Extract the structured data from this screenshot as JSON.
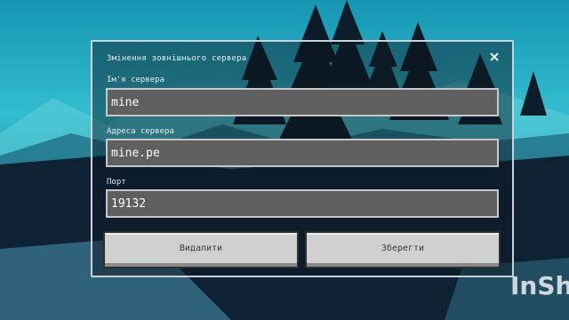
{
  "dialog": {
    "title": "Змінення зовнішнього сервера",
    "close_icon": "close-icon"
  },
  "fields": {
    "server_name": {
      "label": "Ім'я сервера",
      "value": "mine"
    },
    "server_address": {
      "label": "Адреса сервера",
      "value": "mine.pe"
    },
    "port": {
      "label": "Порт",
      "value": "19132"
    }
  },
  "buttons": {
    "delete_label": "Видалити",
    "save_label": "Зберегти"
  },
  "watermark": "InSh",
  "colors": {
    "sky_top": "#1aa6c0",
    "sky_mid": "#38c4d4",
    "ground": "#0e2233",
    "field_bg": "#5f5f5f",
    "button_bg": "#d0d0d0"
  }
}
